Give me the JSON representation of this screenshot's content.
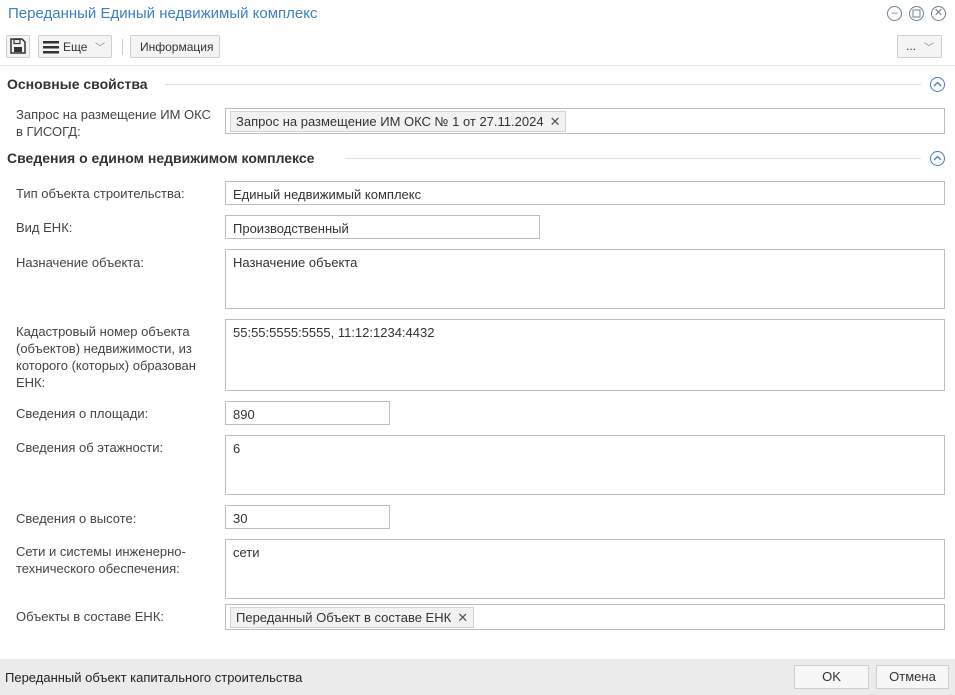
{
  "window": {
    "title": "Переданный Единый недвижимый комплекс"
  },
  "toolbar": {
    "more_label": "Еще",
    "info_label": "Информация",
    "overflow_label": "..."
  },
  "sections": {
    "main": {
      "title": "Основные свойства"
    },
    "enk": {
      "title": "Сведения о едином недвижимом комплексе"
    }
  },
  "fields": {
    "request": {
      "label": "Запрос на размещение ИМ ОКС в ГИСОГД:",
      "tag": "Запрос на размещение ИМ ОКС № 1 от 27.11.2024"
    },
    "construction_type": {
      "label": "Тип объекта строительства:",
      "value": "Единый недвижимый комплекс"
    },
    "enk_kind": {
      "label": "Вид ЕНК:",
      "value": "Производственный"
    },
    "purpose": {
      "label": "Назначение объекта:",
      "value": "Назначение объекта"
    },
    "cadastral": {
      "label": "Кадастровый номер объекта (объектов) недвижимости, из которого (которых) образован ЕНК:",
      "value": "55:55:5555:5555, 11:12:1234:4432"
    },
    "area": {
      "label": "Сведения о площади:",
      "value": "890"
    },
    "floors": {
      "label": "Сведения об этажности:",
      "value": "6"
    },
    "height": {
      "label": "Сведения о высоте:",
      "value": "30"
    },
    "networks": {
      "label": "Сети и системы инженерно-технического обеспечения:",
      "value": "сети"
    },
    "objects": {
      "label": "Объекты в составе ЕНК:",
      "tag": "Переданный Объект в составе ЕНК"
    }
  },
  "status": {
    "text": "Переданный объект капитального строительства"
  },
  "buttons": {
    "ok": "OK",
    "cancel": "Отмена"
  },
  "colors": {
    "accent": "#3f7fc0",
    "border": "#bdbdbd",
    "statusbar": "#ebebeb"
  }
}
